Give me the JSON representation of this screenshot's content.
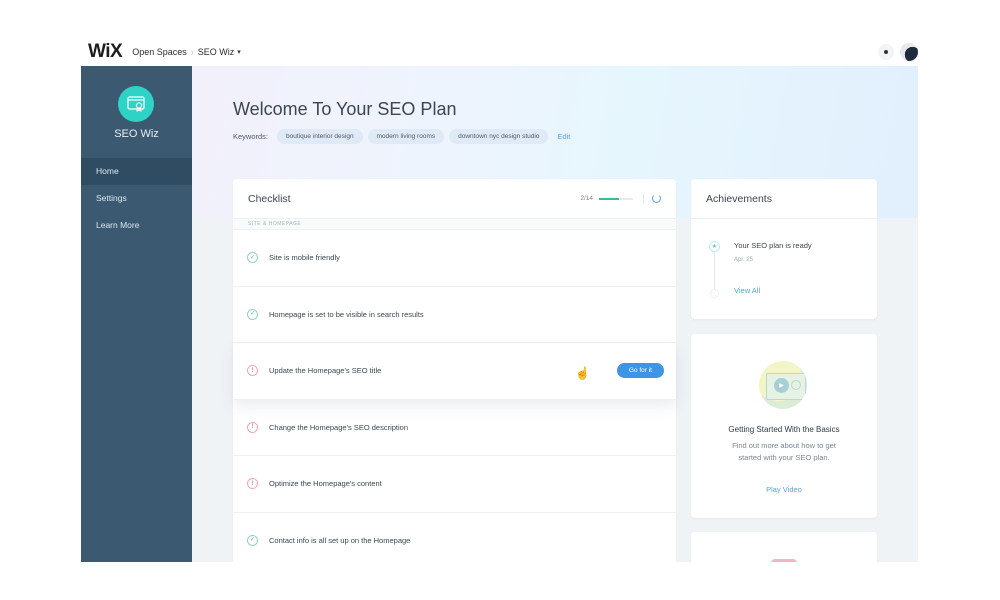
{
  "topbar": {
    "logo": "WiX",
    "breadcrumb": [
      "Open Spaces",
      "SEO Wiz"
    ],
    "breadcrumb_separator": "›",
    "dropdown_caret": "▾",
    "icons": [
      "notifications-icon",
      "user-avatar"
    ]
  },
  "sidebar": {
    "app_name": "SEO Wiz",
    "app_icon": "browser-badge-icon",
    "app_icon_color": "#2ed3c6",
    "background_color": "#3b5a72",
    "items": [
      {
        "label": "Home",
        "active": true
      },
      {
        "label": "Settings",
        "active": false
      },
      {
        "label": "Learn More",
        "active": false
      }
    ]
  },
  "hero": {
    "title": "Welcome To Your SEO Plan",
    "keywords_label": "Keywords:",
    "keywords": [
      "boutique interior design",
      "modern living rooms",
      "downtown nyc design studio"
    ],
    "edit_label": "Edit"
  },
  "checklist": {
    "title": "Checklist",
    "progress_text": "2/14",
    "progress_fraction": 0.6,
    "progress_color": "#39c08a",
    "section_label": "SITE & HOMEPAGE",
    "items": [
      {
        "text": "Site is mobile friendly",
        "status": "done",
        "icon": "✓"
      },
      {
        "text": "Homepage is set to be visible in search results",
        "status": "done",
        "icon": "✓"
      },
      {
        "text": "Update the Homepage's SEO title",
        "status": "todo",
        "icon": "!",
        "action": "Go for it"
      },
      {
        "text": "Change the Homepage's SEO description",
        "status": "todo",
        "icon": "!"
      },
      {
        "text": "Optimize the Homepage's content",
        "status": "todo",
        "icon": "!"
      },
      {
        "text": "Contact info is all set up on the Homepage",
        "status": "done",
        "icon": "✓"
      }
    ],
    "accent_color": "#3d95e4"
  },
  "achievements": {
    "title": "Achievements",
    "items": [
      {
        "text": "Your SEO plan is ready",
        "date": "Apr. 25",
        "icon": "★"
      }
    ],
    "view_all_label": "View All"
  },
  "video_card": {
    "title": "Getting Started With the Basics",
    "description": "Find out more about how to get started with your SEO plan.",
    "link_label": "Play Video",
    "play_icon": "▶"
  },
  "cursor": "☝"
}
